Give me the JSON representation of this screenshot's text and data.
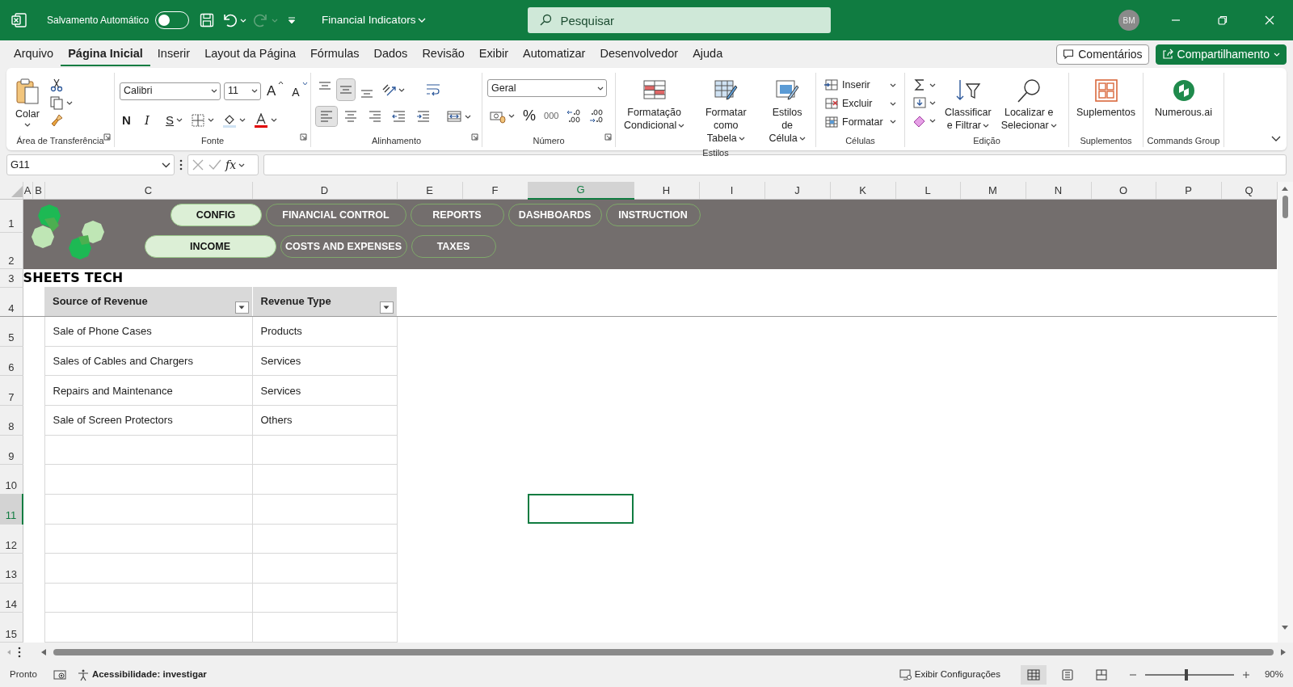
{
  "title_bar": {
    "autosave_label": "Salvamento Automático",
    "autosave_on": false,
    "document_title": "Financial Indicators",
    "search_placeholder": "Pesquisar",
    "user_initials": "BM"
  },
  "menu_tabs": [
    {
      "label": "Arquivo",
      "selected": false
    },
    {
      "label": "Página Inicial",
      "selected": true
    },
    {
      "label": "Inserir",
      "selected": false
    },
    {
      "label": "Layout da Página",
      "selected": false
    },
    {
      "label": "Fórmulas",
      "selected": false
    },
    {
      "label": "Dados",
      "selected": false
    },
    {
      "label": "Revisão",
      "selected": false
    },
    {
      "label": "Exibir",
      "selected": false
    },
    {
      "label": "Automatizar",
      "selected": false
    },
    {
      "label": "Desenvolvedor",
      "selected": false
    },
    {
      "label": "Ajuda",
      "selected": false
    }
  ],
  "header_buttons": [
    {
      "label": "Comentários",
      "kind": "outline"
    },
    {
      "label": "Compartilhamento",
      "kind": "primary"
    }
  ],
  "ribbon_groups": [
    {
      "kind": "clipboard",
      "name": "Área de Transferência",
      "paste_label": "Colar"
    },
    {
      "kind": "font",
      "name": "Fonte",
      "font_name": "Calibri",
      "font_size": "11",
      "grow": "A",
      "shrink": "A",
      "bold": "N",
      "italic": "I",
      "underline": "S"
    },
    {
      "kind": "alignment",
      "name": "Alinhamento",
      "vertical_align": [
        {
          "selected": false
        },
        {
          "selected": true
        },
        {
          "selected": false
        }
      ],
      "horizontal_align": [
        {
          "selected": true
        },
        {
          "selected": false
        },
        {
          "selected": false
        }
      ]
    },
    {
      "kind": "number",
      "name": "Número",
      "format": "Geral",
      "percent": "%",
      "thousands": "000"
    },
    {
      "kind": "styles",
      "name": "Estilos",
      "buttons": [
        {
          "lines": [
            "Formatação",
            "Condicional"
          ]
        },
        {
          "lines": [
            "Formatar como",
            "Tabela"
          ]
        },
        {
          "lines": [
            "Estilos de",
            "Célula"
          ]
        }
      ]
    },
    {
      "kind": "cells",
      "name": "Células",
      "buttons": [
        {
          "label": "Inserir"
        },
        {
          "label": "Excluir"
        },
        {
          "label": "Formatar"
        }
      ]
    },
    {
      "kind": "editing",
      "name": "Edição",
      "buttons": [
        {
          "lines": [
            "Classificar",
            "e Filtrar"
          ]
        },
        {
          "lines": [
            "Localizar e",
            "Selecionar"
          ]
        }
      ]
    },
    {
      "kind": "addins",
      "name": "Suplementos",
      "buttons": [
        {
          "lines": [
            "Suplementos"
          ]
        }
      ]
    },
    {
      "kind": "commands",
      "name": "Commands Group",
      "buttons": [
        {
          "lines": [
            "Numerous.ai"
          ]
        }
      ]
    }
  ],
  "formula_bar": {
    "name_box": "G11",
    "function_symbol": "fx"
  },
  "columns": [
    {
      "label": "A",
      "selected": false
    },
    {
      "label": "B",
      "selected": false
    },
    {
      "label": "C",
      "selected": false
    },
    {
      "label": "D",
      "selected": false
    },
    {
      "label": "E",
      "selected": false
    },
    {
      "label": "F",
      "selected": false
    },
    {
      "label": "G",
      "selected": true
    },
    {
      "label": "H",
      "selected": false
    },
    {
      "label": "I",
      "selected": false
    },
    {
      "label": "J",
      "selected": false
    },
    {
      "label": "K",
      "selected": false
    },
    {
      "label": "L",
      "selected": false
    },
    {
      "label": "M",
      "selected": false
    },
    {
      "label": "N",
      "selected": false
    },
    {
      "label": "O",
      "selected": false
    },
    {
      "label": "P",
      "selected": false
    },
    {
      "label": "Q",
      "selected": false
    }
  ],
  "rows": [
    {
      "label": "1",
      "selected": false
    },
    {
      "label": "2",
      "selected": false
    },
    {
      "label": "3",
      "selected": false
    },
    {
      "label": "4",
      "selected": false
    },
    {
      "label": "5",
      "selected": false
    },
    {
      "label": "6",
      "selected": false
    },
    {
      "label": "7",
      "selected": false
    },
    {
      "label": "8",
      "selected": false
    },
    {
      "label": "9",
      "selected": false
    },
    {
      "label": "10",
      "selected": false
    },
    {
      "label": "11",
      "selected": true
    },
    {
      "label": "12",
      "selected": false
    },
    {
      "label": "13",
      "selected": false
    },
    {
      "label": "14",
      "selected": false
    },
    {
      "label": "15",
      "selected": false
    }
  ],
  "nav_rows": [
    [
      {
        "label": "CONFIG",
        "selected": true
      },
      {
        "label": "FINANCIAL CONTROL",
        "selected": false
      },
      {
        "label": "REPORTS",
        "selected": false
      },
      {
        "label": "DASHBOARDS",
        "selected": false
      },
      {
        "label": "INSTRUCTION",
        "selected": false
      }
    ],
    [
      {
        "label": "INCOME",
        "selected": true
      },
      {
        "label": "COSTS AND EXPENSES",
        "selected": false
      },
      {
        "label": "TAXES",
        "selected": false
      }
    ]
  ],
  "brand": "SHEETS TECH",
  "table": {
    "columns": [
      "Source of Revenue",
      "Revenue Type"
    ],
    "rows": [
      [
        "Sale of Phone Cases",
        "Products"
      ],
      [
        "Sales of Cables and Chargers",
        "Services"
      ],
      [
        "Repairs and Maintenance",
        "Services"
      ],
      [
        "Sale of Screen Protectors",
        "Others"
      ]
    ]
  },
  "status_bar": {
    "status": "Pronto",
    "accessibility": "Acessibilidade: investigar",
    "display_settings": "Exibir Configurações",
    "views": [
      {
        "selected": true
      },
      {
        "selected": false
      },
      {
        "selected": false
      }
    ],
    "zoom_slider": {
      "level": 0.46
    },
    "zoom": "90%"
  }
}
